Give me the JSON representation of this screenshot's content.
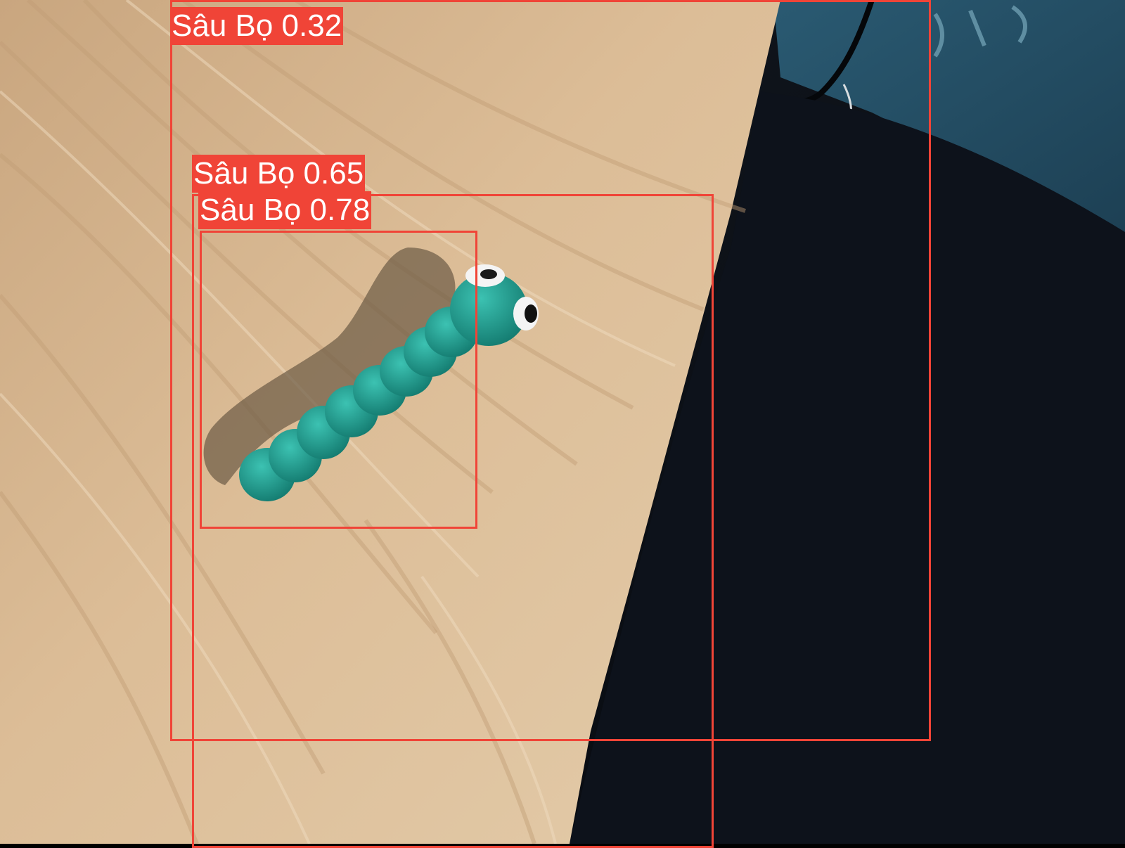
{
  "detections": [
    {
      "class_label": "Sâu Bọ",
      "confidence": "0.32",
      "text": "Sâu Bọ 0.32"
    },
    {
      "class_label": "Sâu Bọ",
      "confidence": "0.65",
      "text": "Sâu Bọ 0.65"
    },
    {
      "class_label": "Sâu Bọ",
      "confidence": "0.78",
      "text": "Sâu Bọ 0.78"
    }
  ],
  "colors": {
    "box": "#f04437",
    "label_text": "#ffffff",
    "wood": "#d9b68c",
    "caterpillar": "#1f9a8e",
    "dark_area": "#0b0e16"
  },
  "scene": {
    "objects": [
      "wooden-table",
      "clay-caterpillar",
      "dark-fabric",
      "book-cover"
    ]
  }
}
